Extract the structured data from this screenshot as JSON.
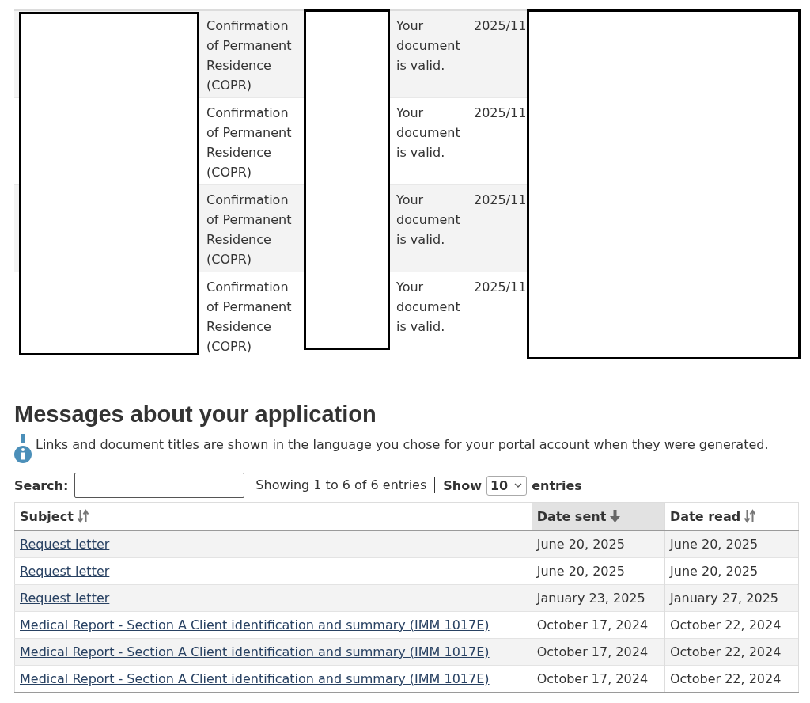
{
  "documents_table": {
    "rows": [
      {
        "column_2": "Confirmation of Permanent Residence (COPR)",
        "column_4": "Your document is valid.",
        "column_5": "2025/11"
      },
      {
        "column_2": "Confirmation of Permanent Residence (COPR)",
        "column_4": "Your document is valid.",
        "column_5": "2025/11"
      },
      {
        "column_2": "Confirmation of Permanent Residence (COPR)",
        "column_4": "Your document is valid.",
        "column_5": "2025/11"
      },
      {
        "column_2": "Confirmation of Permanent Residence (COPR)",
        "column_4": "Your document is valid.",
        "column_5": "2025/11"
      }
    ]
  },
  "messages": {
    "heading": "Messages about your application",
    "note": "Links and document titles are shown in the language you chose for your portal account when they were generated.",
    "search": {
      "label": "Search:"
    },
    "info": "Showing 1 to 6 of 6 entries",
    "page_size": {
      "prefix": "Show",
      "value": "10",
      "suffix": "entries"
    },
    "table": {
      "columns": [
        {
          "label": "Subject",
          "selected": false
        },
        {
          "label": "Date sent",
          "selected": true
        },
        {
          "label": "Date read",
          "selected": false
        }
      ],
      "rows": [
        {
          "subject": "Request letter",
          "date_sent": "June 20, 2025",
          "date_read": "June 20, 2025"
        },
        {
          "subject": "Request letter",
          "date_sent": "June 20, 2025",
          "date_read": "June 20, 2025"
        },
        {
          "subject": "Request letter",
          "date_sent": "January 23, 2025",
          "date_read": "January 27, 2025"
        },
        {
          "subject": "Medical Report - Section A Client identification and summary (IMM 1017E)",
          "date_sent": "October 17, 2024",
          "date_read": "October 22, 2024"
        },
        {
          "subject": "Medical Report - Section A Client identification and summary (IMM 1017E)",
          "date_sent": "October 17, 2024",
          "date_read": "October 22, 2024"
        },
        {
          "subject": "Medical Report - Section A Client identification and summary (IMM 1017E)",
          "date_sent": "October 17, 2024",
          "date_read": "October 22, 2024"
        }
      ]
    }
  }
}
